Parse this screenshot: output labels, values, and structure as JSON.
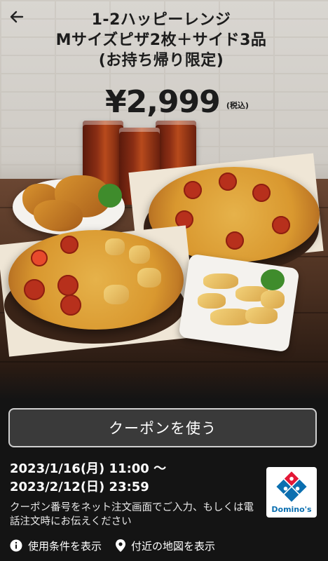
{
  "hero": {
    "title_lines": [
      "1-2ハッピーレンジ",
      "Mサイズピザ2枚＋サイド3品",
      "(お持ち帰り限定)"
    ],
    "price": "¥2,999",
    "tax_note": "(税込)"
  },
  "actions": {
    "use_coupon_label": "クーポンを使う"
  },
  "validity": {
    "line1": "2023/1/16(月) 11:00 〜",
    "line2": "2023/2/12(日) 23:59"
  },
  "instructions": "クーポン番号をネット注文画面でご入力、もしくは電話注文時にお伝えください",
  "brand": {
    "name": "Domino's",
    "colors": {
      "blue": "#0b6fb0",
      "red": "#e31837"
    }
  },
  "footer_links": {
    "terms_label": "使用条件を表示",
    "map_label": "付近の地図を表示"
  },
  "icons": {
    "back": "arrow-left-icon",
    "info": "info-icon",
    "map": "map-pin-icon"
  }
}
